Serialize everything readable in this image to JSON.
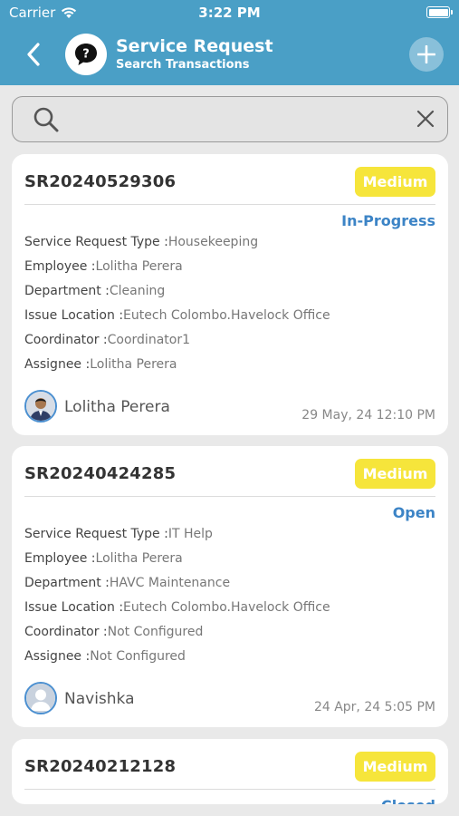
{
  "status_bar": {
    "carrier": "Carrier",
    "time": "3:22 PM"
  },
  "header": {
    "title": "Service Request",
    "subtitle": "Search Transactions"
  },
  "search": {
    "placeholder": "",
    "value": ""
  },
  "labels": {
    "type": "Service Request Type :",
    "employee": "Employee :",
    "department": "Department :",
    "location": "Issue Location :",
    "coordinator": "Coordinator :",
    "assignee": "Assignee :"
  },
  "requests": [
    {
      "number": "SR20240529306",
      "priority": "Medium",
      "status": "In-Progress",
      "type": "Housekeeping",
      "employee": "Lolitha Perera",
      "department": "Cleaning",
      "location": "Eutech Colombo.Havelock Office",
      "coordinator": "Coordinator1",
      "assignee": "Lolitha Perera",
      "person": "Lolitha Perera",
      "date": "29 May, 24 12:10 PM"
    },
    {
      "number": "SR20240424285",
      "priority": "Medium",
      "status": "Open",
      "type": "IT Help",
      "employee": "Lolitha Perera",
      "department": "HAVC Maintenance",
      "location": "Eutech Colombo.Havelock Office",
      "coordinator": "Not Configured",
      "assignee": "Not Configured",
      "person": "Navishka",
      "date": "24 Apr, 24 5:05 PM"
    },
    {
      "number": "SR20240212128",
      "priority": "Medium",
      "status": "Closed"
    }
  ],
  "colors": {
    "header": "#4a9fc6",
    "priority": "#f6e53b",
    "status": "#3c84c6"
  }
}
